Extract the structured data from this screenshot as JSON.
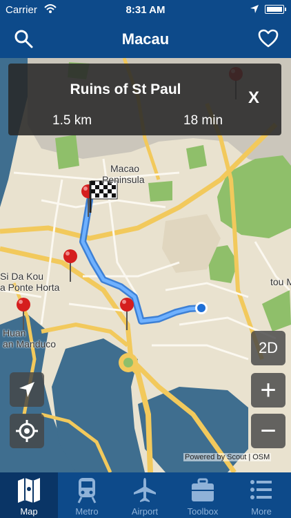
{
  "status": {
    "carrier": "Carrier",
    "time": "8:31 AM"
  },
  "nav": {
    "title": "Macau"
  },
  "route": {
    "destination": "Ruins of St Paul",
    "distance": "1.5 km",
    "duration": "18 min",
    "close_label": "X"
  },
  "map_labels": {
    "macao": "Macao",
    "peninsula": "Peninsula",
    "sida": "Si Da Kou",
    "ponte": "a Ponte Horta",
    "huan": "Huan",
    "manduco": "an Manduco",
    "toum": "tou M"
  },
  "controls": {
    "mode_label": "2D",
    "zoom_in": "+",
    "zoom_out": "−"
  },
  "attribution": "Powered by Scout | OSM",
  "tabs": [
    {
      "label": "Map",
      "icon": "map-icon"
    },
    {
      "label": "Metro",
      "icon": "train-icon"
    },
    {
      "label": "Airport",
      "icon": "airplane-icon"
    },
    {
      "label": "Toolbox",
      "icon": "toolbox-icon"
    },
    {
      "label": "More",
      "icon": "list-icon"
    }
  ],
  "colors": {
    "bar": "#0d4a8a",
    "tab_active": "#0a3566",
    "route": "#3d8ee8"
  }
}
